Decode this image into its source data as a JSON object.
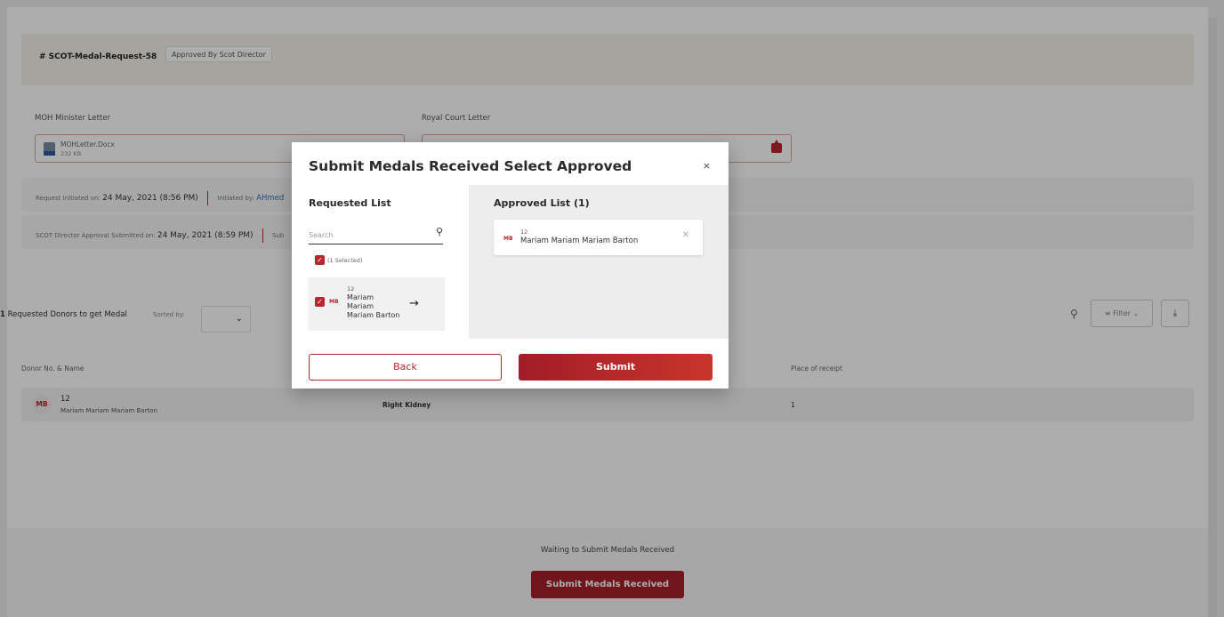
{
  "header": {
    "request_id": "# SCOT-Medal-Request-58",
    "status": "Approved By Scot Director"
  },
  "files": {
    "moh_label": "MOH Minister Letter",
    "moh_file_name": "MOHLetter.Docx",
    "moh_file_size": "232 KB",
    "royal_label": "Royal Court Letter"
  },
  "request_info": {
    "initiated_label": "Request Initiated on:",
    "initiated_date": "24 May, 2021 (8:56 PM)",
    "initiated_by_label": "Initiated by:",
    "initiated_by": "AHmed"
  },
  "director_info": {
    "submitted_label": "SCOT Director Approval Submitted on:",
    "submitted_date": "24 May, 2021 (8:59 PM)",
    "trailing": "Sub"
  },
  "donors": {
    "count": "1",
    "title": "Requested Donors to get Medal",
    "sorted_label": "Sorted by:",
    "filter_label": "Filter",
    "columns": [
      "Donor No. & Name",
      "Place of receipt"
    ],
    "rows": [
      {
        "initials": "MB",
        "number": "12",
        "name": "Mariam Mariam Mariam Barton",
        "organ": "Right Kidney",
        "place": "1"
      }
    ]
  },
  "footer": {
    "waiting_text": "Waiting to Submit Medals Received",
    "submit_label": "Submit Medals Received"
  },
  "modal": {
    "title": "Submit Medals Received Select Approved",
    "close": "×",
    "requested_title": "Requested List",
    "search_placeholder": "Search",
    "selected_label": "(1 Selected)",
    "requested_item": {
      "initials": "MB",
      "number": "12",
      "name_line1": "Mariam",
      "name_line2": "Mariam",
      "name_line3": "Mariam Barton"
    },
    "approved_title": "Approved List (1)",
    "approved_item": {
      "initials": "MB",
      "number": "12",
      "name": "Mariam Mariam Mariam Barton"
    },
    "back_label": "Back",
    "submit_label": "Submit"
  },
  "colors": {
    "accent": "#b8262e",
    "accent_dark": "#a21d28",
    "link": "#2f6fb0"
  },
  "icons": [
    "file-icon",
    "upload-icon",
    "search-icon",
    "filter-icon",
    "download-icon",
    "close-icon",
    "arrow-right-icon",
    "check-icon",
    "remove-icon",
    "chevron-down-icon"
  ]
}
